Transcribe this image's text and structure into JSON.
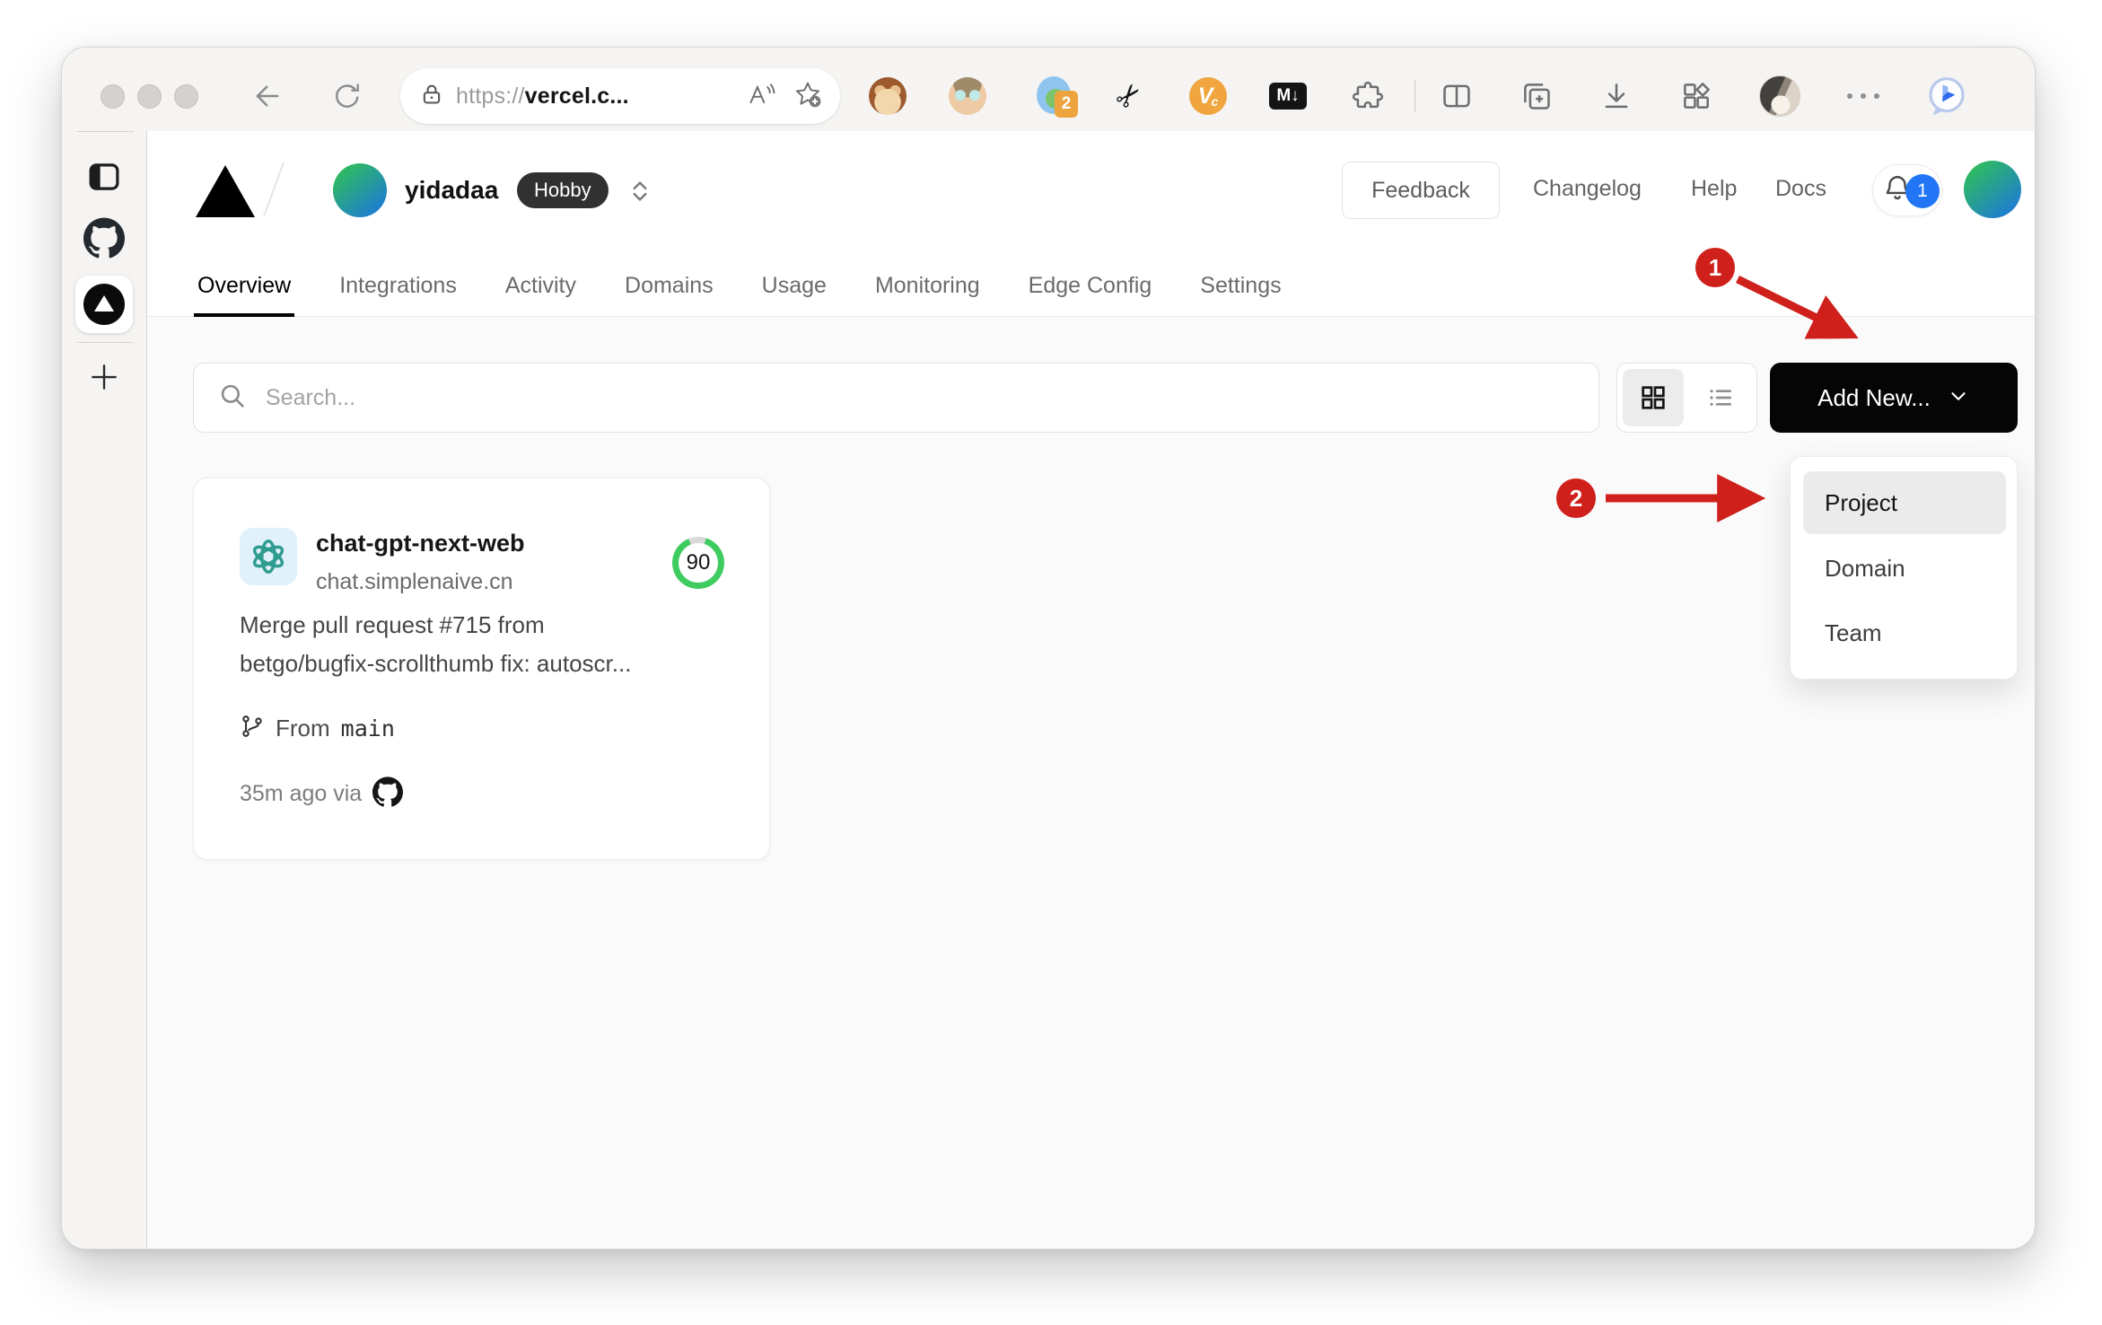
{
  "browser": {
    "url": {
      "scheme": "https://",
      "host": "vercel.c..."
    },
    "extensions": {
      "translate_badge": "2",
      "v_label": "V",
      "v_sub": "c",
      "markdown_label": "M↓"
    }
  },
  "header": {
    "team_name": "yidadaa",
    "plan_badge": "Hobby",
    "feedback_label": "Feedback",
    "links": [
      {
        "label": "Changelog"
      },
      {
        "label": "Help"
      },
      {
        "label": "Docs"
      }
    ],
    "notification_count": "1"
  },
  "tabs": [
    {
      "label": "Overview"
    },
    {
      "label": "Integrations"
    },
    {
      "label": "Activity"
    },
    {
      "label": "Domains"
    },
    {
      "label": "Usage"
    },
    {
      "label": "Monitoring"
    },
    {
      "label": "Edge Config"
    },
    {
      "label": "Settings"
    }
  ],
  "toolbar": {
    "search_placeholder": "Search...",
    "add_new_label": "Add New..."
  },
  "dropdown": {
    "items": [
      {
        "label": "Project"
      },
      {
        "label": "Domain"
      },
      {
        "label": "Team"
      }
    ]
  },
  "project_card": {
    "name": "chat-gpt-next-web",
    "domain": "chat.simplenaive.cn",
    "score": "90",
    "commit_line1": "Merge pull request #715 from",
    "commit_line2": "betgo/bugfix-scrollthumb fix: autoscr...",
    "branch_prefix": "From",
    "branch_name": "main",
    "meta": "35m ago via"
  },
  "annotations": {
    "step1": "1",
    "step2": "2"
  },
  "colors": {
    "accent_red": "#cf201b",
    "score_green": "#3ecb5f",
    "notification_blue": "#2276f5",
    "button_black": "#050505",
    "avatar_gradient_start": "#2fbe5a",
    "avatar_gradient_end": "#1e7ad6"
  }
}
